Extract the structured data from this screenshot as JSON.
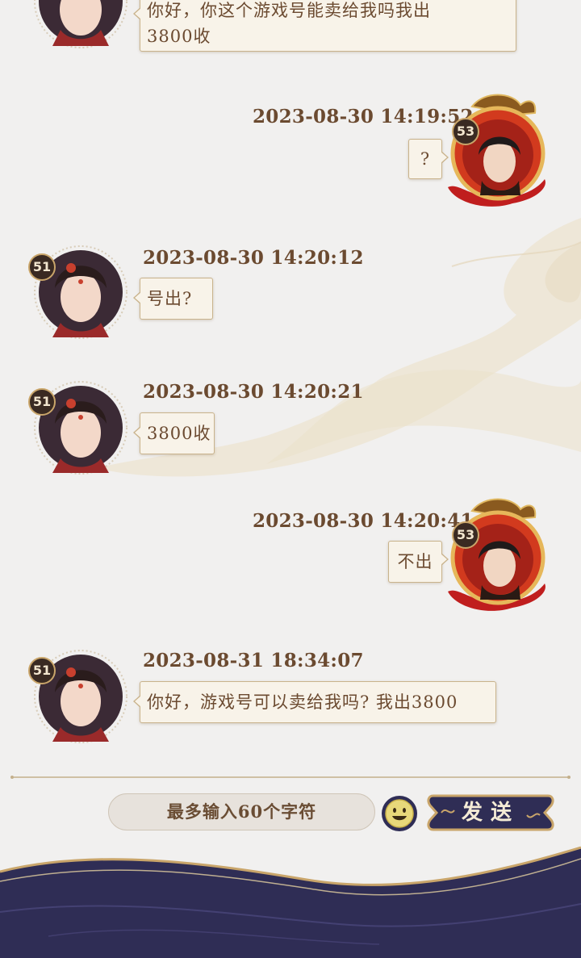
{
  "messages": [
    {
      "side": "left",
      "level": "",
      "time": "",
      "text_line1": "你好，你这个游戏号能卖给我吗我出",
      "text_line2": "3800收"
    },
    {
      "side": "right",
      "level": "53",
      "time": "2023-08-30 14:19:52",
      "text": "?"
    },
    {
      "side": "left",
      "level": "51",
      "time": "2023-08-30 14:20:12",
      "text": "号出?"
    },
    {
      "side": "left",
      "level": "51",
      "time": "2023-08-30 14:20:21",
      "text": "3800收"
    },
    {
      "side": "right",
      "level": "53",
      "time": "2023-08-30 14:20:41",
      "text": "不出"
    },
    {
      "side": "left",
      "level": "51",
      "time": "2023-08-31 18:34:07",
      "text": "你好，游戏号可以卖给我吗? 我出3800"
    }
  ],
  "input": {
    "placeholder": "最多输入60个字符"
  },
  "send_button": {
    "label": "发送"
  },
  "icons": {
    "emoji": "smiley-face-icon"
  },
  "colors": {
    "background": "#f1f0ef",
    "bubble": "#f8f3e9",
    "bubble_border": "#c9b38c",
    "text": "#6b4a30",
    "footer": "#2f2d55",
    "gold": "#c9a56a"
  }
}
